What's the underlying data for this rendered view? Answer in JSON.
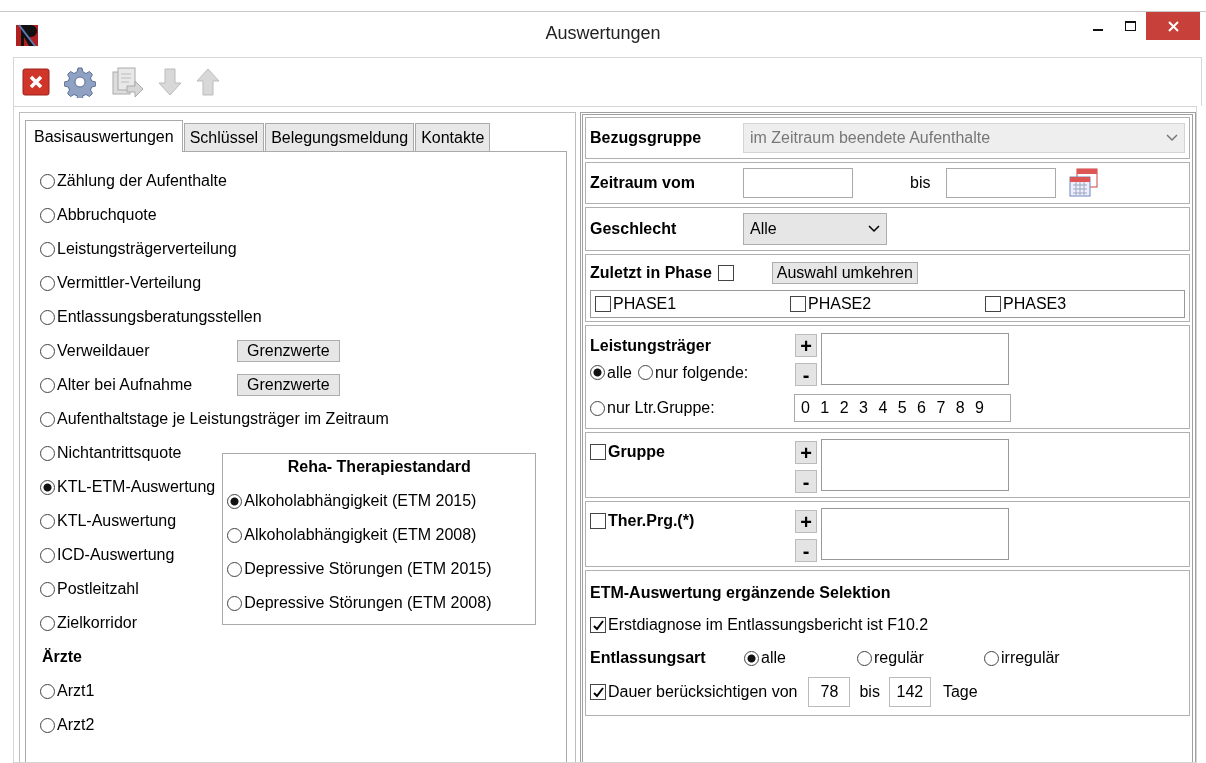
{
  "window": {
    "title": "Auswertungen"
  },
  "toolbar": [
    {
      "kind": "close",
      "disabled": false
    },
    {
      "kind": "settings",
      "disabled": false
    },
    {
      "kind": "export",
      "disabled": true
    },
    {
      "kind": "down",
      "disabled": true
    },
    {
      "kind": "up",
      "disabled": true
    }
  ],
  "tabs": [
    {
      "label": "Basisauswertungen",
      "selected": true
    },
    {
      "label": "Schlüssel",
      "selected": false
    },
    {
      "label": "Belegungsmeldung",
      "selected": false
    },
    {
      "label": "Kontakte",
      "selected": false
    }
  ],
  "analyses": [
    {
      "label": "Zählung der Aufenthalte",
      "selected": false
    },
    {
      "label": "Abbruchquote",
      "selected": false
    },
    {
      "label": "Leistungsträgerverteilung",
      "selected": false
    },
    {
      "label": "Vermittler-Verteilung",
      "selected": false
    },
    {
      "label": "Entlassungsberatungsstellen",
      "selected": false
    },
    {
      "label": "Verweildauer",
      "selected": false,
      "button": "Grenzwerte"
    },
    {
      "label": "Alter bei Aufnahme",
      "selected": false,
      "button": "Grenzwerte"
    },
    {
      "label": "Aufenthaltstage je Leistungsträger im Zeitraum",
      "selected": false
    },
    {
      "label": "Nichtantrittsquote",
      "selected": false
    },
    {
      "label": "KTL-ETM-Auswertung",
      "selected": true
    },
    {
      "label": "KTL-Auswertung",
      "selected": false
    },
    {
      "label": "ICD-Auswertung",
      "selected": false
    },
    {
      "label": "Postleitzahl",
      "selected": false
    },
    {
      "label": "Zielkorridor",
      "selected": false
    }
  ],
  "reha_standard": {
    "title": "Reha- Therapiestandard",
    "options": [
      {
        "label": "Alkoholabhängigkeit (ETM 2015)",
        "selected": true
      },
      {
        "label": "Alkoholabhängigkeit (ETM 2008)",
        "selected": false
      },
      {
        "label": "Depressive Störungen (ETM 2015)",
        "selected": false
      },
      {
        "label": "Depressive Störungen (ETM 2008)",
        "selected": false
      }
    ]
  },
  "aerzte": {
    "heading": "Ärzte",
    "items": [
      {
        "label": "Arzt1",
        "selected": false
      },
      {
        "label": "Arzt2",
        "selected": false
      }
    ]
  },
  "bezugsgruppe": {
    "label": "Bezugsgruppe",
    "value": "im Zeitraum beendete Aufenthalte",
    "disabled": true
  },
  "zeitraum": {
    "label": "Zeitraum vom",
    "separator": "bis"
  },
  "geschlecht": {
    "label": "Geschlecht",
    "value": "Alle"
  },
  "phase": {
    "label": "Zuletzt in Phase",
    "checked": false,
    "button": "Auswahl umkehren",
    "phases": [
      {
        "label": "PHASE1",
        "checked": false
      },
      {
        "label": "PHASE2",
        "checked": false
      },
      {
        "label": "PHASE3",
        "checked": false
      }
    ]
  },
  "leistungstraeger": {
    "label": "Leistungsträger",
    "add": "+",
    "remove": "-",
    "options": [
      {
        "label": "alle",
        "selected": true
      },
      {
        "label": "nur folgende:",
        "selected": false
      },
      {
        "label": "nur Ltr.Gruppe:",
        "selected": false
      }
    ],
    "group_value": "0 1 2 3 4 5 6 7 8 9"
  },
  "gruppe": {
    "label": "Gruppe",
    "checked": false,
    "add": "+",
    "remove": "-"
  },
  "ther_prg": {
    "label": "Ther.Prg.(*)",
    "checked": false,
    "add": "+",
    "remove": "-"
  },
  "etm": {
    "title": "ETM-Auswertung ergänzende Selektion",
    "erstdiagnose": {
      "label": "Erstdiagnose im Entlassungsbericht ist F10.2",
      "checked": true
    },
    "entlassungsart": {
      "label": "Entlassungsart",
      "options": [
        {
          "label": "alle",
          "selected": true
        },
        {
          "label": "regulär",
          "selected": false
        },
        {
          "label": "irregulär",
          "selected": false
        }
      ]
    },
    "dauer": {
      "label": "Dauer berücksichtigen von",
      "checked": true,
      "from": "78",
      "separator": "bis",
      "to": "142",
      "unit": "Tage"
    }
  }
}
